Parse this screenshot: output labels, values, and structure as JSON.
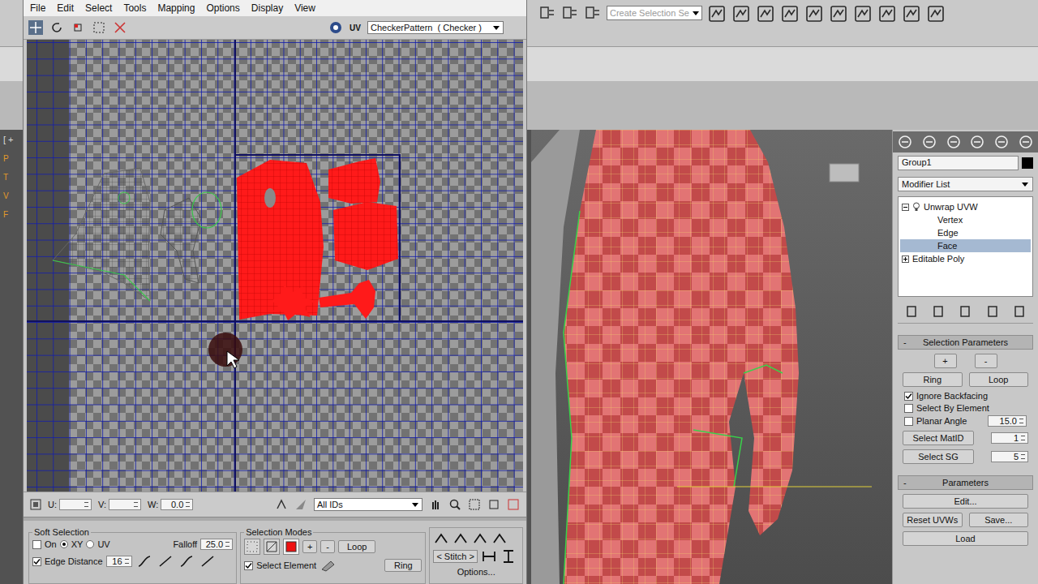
{
  "toolbar": {
    "selection_set": "Create Selection Se"
  },
  "viewport": {
    "label": "[ +",
    "side_letters": [
      "P",
      "T",
      "V",
      "F"
    ]
  },
  "uv_editor": {
    "menu": [
      "File",
      "Edit",
      "Select",
      "Tools",
      "Mapping",
      "Options",
      "Display",
      "View"
    ],
    "uv_label": "UV",
    "texture": "CheckerPattern  ( Checker )",
    "coords": [
      {
        "label": "U:",
        "value": ""
      },
      {
        "label": "V:",
        "value": ""
      },
      {
        "label": "W:",
        "value": "0.0"
      }
    ],
    "id_filter": "All IDs"
  },
  "soft_selection": {
    "title": "Soft Selection",
    "on": {
      "label": "On",
      "checked": false
    },
    "space": [
      {
        "label": "XY",
        "selected": true
      },
      {
        "label": "UV",
        "selected": false
      }
    ],
    "falloff": {
      "label": "Falloff",
      "value": "25.0"
    },
    "edge_distance": {
      "label": "Edge Distance",
      "checked": true,
      "value": "16"
    }
  },
  "selection_modes": {
    "title": "Selection Modes",
    "modes": [
      {
        "kind": "vertex",
        "selected": false
      },
      {
        "kind": "edge",
        "selected": false
      },
      {
        "kind": "face",
        "selected": true
      }
    ],
    "grow": "+",
    "shrink": "-",
    "loop": "Loop",
    "ring": "Ring",
    "select_element": {
      "label": "Select Element",
      "checked": true
    }
  },
  "stitch": {
    "prefix": "<",
    "label": "Stitch",
    "suffix": ">",
    "options": "Options..."
  },
  "command_panel": {
    "object_name": "Group1",
    "modifier_list": "Modifier List",
    "stack": [
      {
        "label": "Unwrap UVW",
        "kind": "modifier",
        "expanded": true,
        "selected": false
      },
      {
        "label": "Vertex",
        "kind": "sub",
        "expanded": false,
        "selected": false
      },
      {
        "label": "Edge",
        "kind": "sub",
        "expanded": false,
        "selected": false
      },
      {
        "label": "Face",
        "kind": "sub",
        "expanded": false,
        "selected": true
      },
      {
        "label": "Editable Poly",
        "kind": "modifier",
        "expanded": false,
        "selected": false
      }
    ],
    "selection_parameters": {
      "collapse": "-",
      "title": "Selection Parameters",
      "grow": "+",
      "shrink": "-",
      "ring": "Ring",
      "loop": "Loop",
      "options": [
        {
          "label": "Ignore Backfacing",
          "checked": true,
          "value": ""
        },
        {
          "label": "Select By Element",
          "checked": false,
          "value": ""
        },
        {
          "label": "Planar Angle",
          "checked": false,
          "value": "15.0"
        }
      ],
      "select_matid": {
        "label": "Select MatID",
        "value": "1"
      },
      "select_sg": {
        "label": "Select SG",
        "value": "5"
      }
    },
    "parameters": {
      "collapse": "-",
      "title": "Parameters",
      "edit": "Edit...",
      "reset": "Reset UVWs",
      "save": "Save...",
      "load": "Load"
    }
  }
}
